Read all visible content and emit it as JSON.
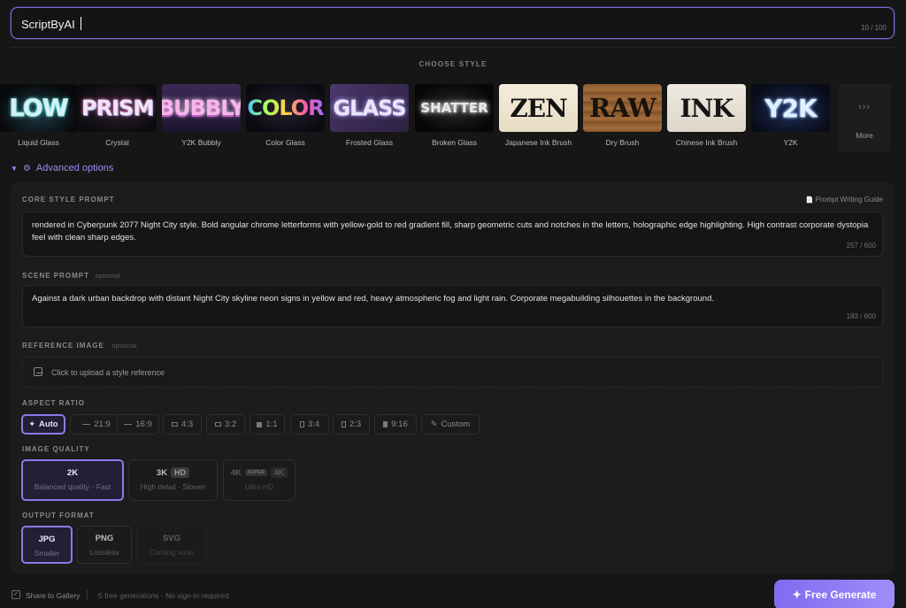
{
  "title_input": {
    "value": "ScriptByAI",
    "counter": "10 / 100"
  },
  "choose_style_label": "CHOOSE STYLE",
  "styles": [
    {
      "word": "LOW",
      "label": "Liquid Glass",
      "icon": "liquid-glass-thumb"
    },
    {
      "word": "PRISM",
      "label": "Crystal",
      "icon": "crystal-thumb"
    },
    {
      "word": "BUBBLY",
      "label": "Y2K Bubbly",
      "icon": "y2k-bubbly-thumb"
    },
    {
      "word": "COLOR",
      "label": "Color Glass",
      "icon": "color-glass-thumb"
    },
    {
      "word": "GLASS",
      "label": "Frosted Glass",
      "icon": "frosted-glass-thumb"
    },
    {
      "word": "SHATTER",
      "label": "Broken Glass",
      "icon": "broken-glass-thumb"
    },
    {
      "word": "ZEN",
      "label": "Japanese Ink Brush",
      "icon": "japanese-ink-thumb"
    },
    {
      "word": "RAW",
      "label": "Dry Brush",
      "icon": "dry-brush-thumb"
    },
    {
      "word": "INK",
      "label": "Chinese Ink Brush",
      "icon": "chinese-ink-thumb"
    },
    {
      "word": "Y2K",
      "label": "Y2K",
      "icon": "y2k-thumb"
    }
  ],
  "more": {
    "arrows": "›››",
    "label": "More"
  },
  "advanced": {
    "label": "Advanced options",
    "arrow": "▼",
    "gear": "⚙"
  },
  "core_prompt": {
    "label": "CORE STYLE PROMPT",
    "guide": "Prompt Writing Guide",
    "guide_icon": "📄",
    "text": "rendered in Cyberpunk 2077 Night City style. Bold angular chrome letterforms with yellow-gold to red gradient fill, sharp geometric cuts and notches in the letters, holographic edge highlighting. High contrast corporate dystopia feel with clean sharp edges.",
    "counter": "257 / 600"
  },
  "scene_prompt": {
    "label": "SCENE PROMPT",
    "optional": "optional",
    "text": "Against a dark urban backdrop with distant Night City skyline neon signs in yellow and red, heavy atmospheric fog and light rain. Corporate megabuilding silhouettes in the background.",
    "counter": "183 / 600"
  },
  "reference": {
    "label": "REFERENCE IMAGE",
    "optional": "· optional",
    "placeholder": "Click to upload a style reference"
  },
  "aspect": {
    "label": "ASPECT RATIO",
    "options": [
      {
        "icon": "✦",
        "label": "Auto"
      },
      {
        "label": "21:9"
      },
      {
        "label": "16:9"
      },
      {
        "label": "4:3"
      },
      {
        "label": "3:2"
      },
      {
        "label": "1:1"
      },
      {
        "label": "3:4"
      },
      {
        "label": "2:3"
      },
      {
        "label": "9:16"
      },
      {
        "icon": "✎",
        "label": "Custom"
      }
    ]
  },
  "quality": {
    "label": "IMAGE QUALITY",
    "options": [
      {
        "title": "2K",
        "sub": "Balanced quality · Fast"
      },
      {
        "title": "3K",
        "badge": "HD",
        "sub": "High detail · Slower"
      },
      {
        "title": "4K",
        "badge_small": "SUPER",
        "badge": "4K",
        "sub": "Ultra HD"
      }
    ]
  },
  "format": {
    "label": "OUTPUT FORMAT",
    "options": [
      {
        "title": "JPG",
        "sub": "Smaller"
      },
      {
        "title": "PNG",
        "sub": "Lossless"
      },
      {
        "title": "SVG",
        "sub": "Coming soon"
      }
    ]
  },
  "bottom": {
    "share_label": "Share to Gallery",
    "check": "✓",
    "info": "5 free generations · No sign-in required",
    "generate_label": "Free Generate",
    "generate_icon": "✦"
  },
  "colors": {
    "accent": "#8d79ea",
    "background": "#161616",
    "panel": "#1c1c1c"
  }
}
